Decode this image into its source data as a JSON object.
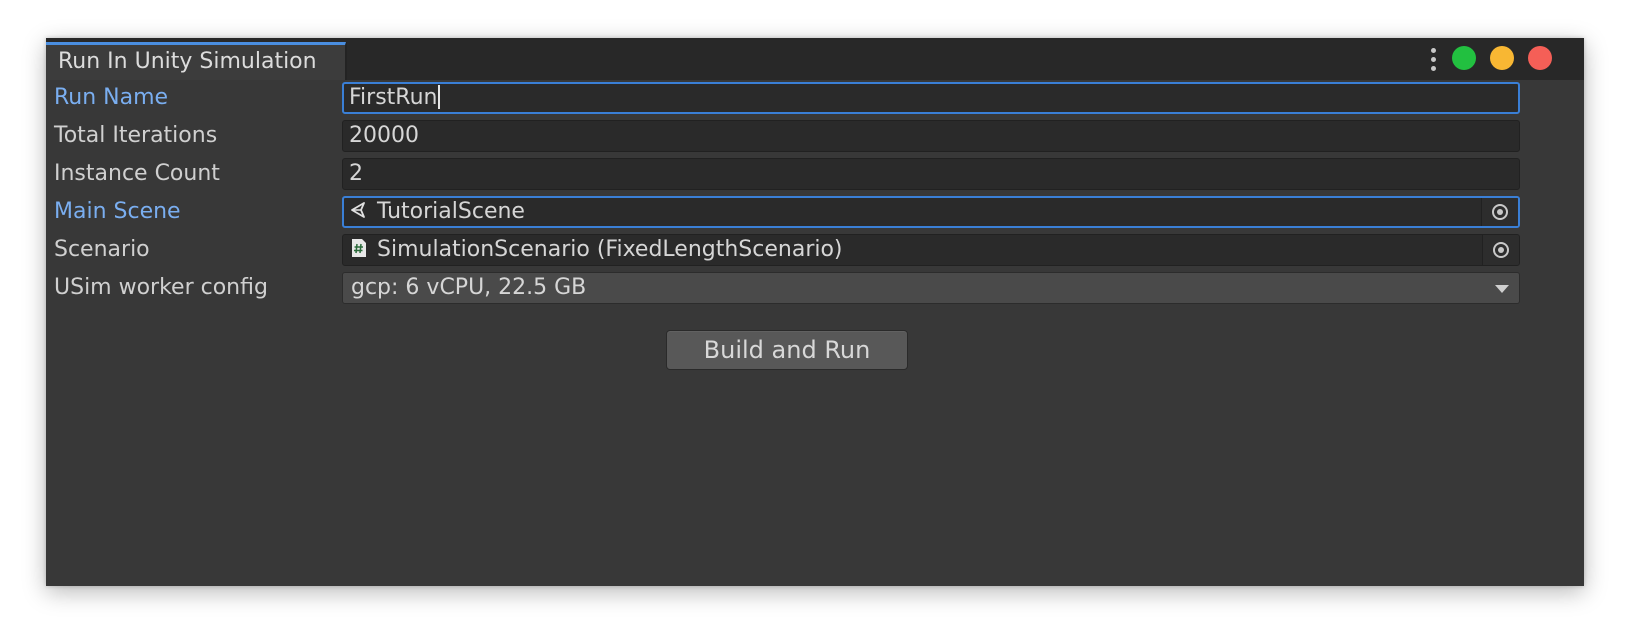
{
  "window": {
    "tab_title": "Run In Unity Simulation",
    "controls": {
      "menu_icon": "kebab-menu-icon",
      "colors": {
        "green": "#28c840",
        "yellow": "#febc2e",
        "red": "#ff5f57"
      }
    }
  },
  "form": {
    "run_name": {
      "label": "Run Name",
      "value": "FirstRun"
    },
    "total_iterations": {
      "label": "Total Iterations",
      "value": "20000"
    },
    "instance_count": {
      "label": "Instance Count",
      "value": "2"
    },
    "main_scene": {
      "label": "Main Scene",
      "value": "TutorialScene",
      "icon": "unity-scene-icon"
    },
    "scenario": {
      "label": "Scenario",
      "value": "SimulationScenario (FixedLengthScenario)",
      "icon": "csharp-script-icon"
    },
    "worker_config": {
      "label": "USim worker config",
      "value": "gcp: 6 vCPU, 22.5 GB"
    }
  },
  "actions": {
    "build_and_run": "Build and Run"
  },
  "theme": {
    "accent": "#3a7fd6",
    "active_label": "#7aaef0"
  }
}
